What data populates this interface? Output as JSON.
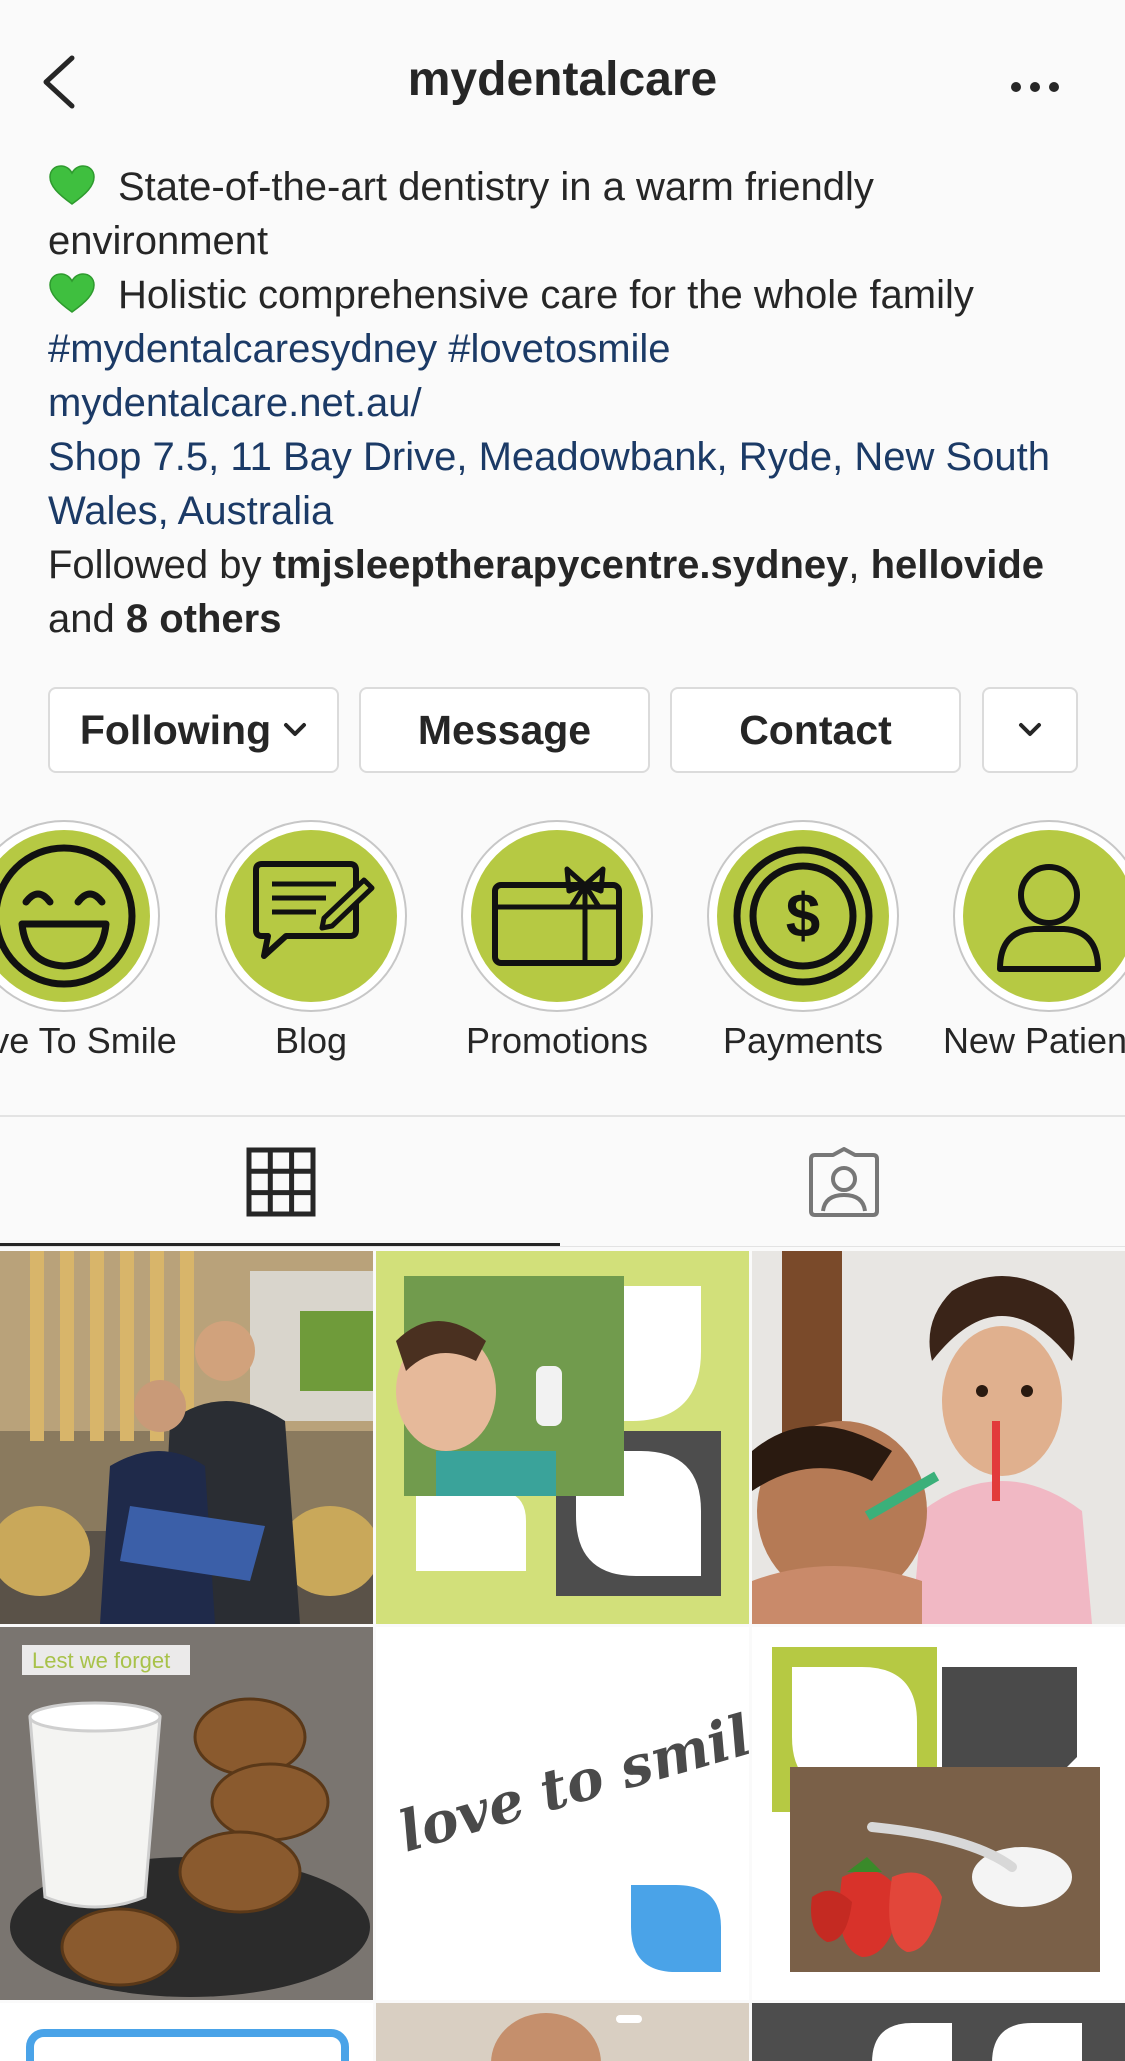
{
  "header": {
    "title": "mydentalcare",
    "back_icon": "chevron-left-icon",
    "more_icon": "ellipsis-icon"
  },
  "bio": {
    "line1": "State-of-the-art dentistry in a warm friendly environment",
    "line2": "Holistic comprehensive care for the whole family",
    "hashtags": "#mydentalcaresydney #lovetosmile",
    "website": "mydentalcare.net.au/",
    "address": "Shop 7.5, 11 Bay Drive, Meadowbank, Ryde, New South Wales, Australia",
    "followed_prefix": "Followed by",
    "follower1": "tmjsleeptherapycentre.sydney",
    "follower2": "hellovide",
    "and_text": "and",
    "others": "8 others",
    "heart_color": "#3fbf3f",
    "link_color": "#1b3a66"
  },
  "actions": {
    "following": "Following",
    "message": "Message",
    "contact": "Contact"
  },
  "highlights": [
    {
      "label": "Love To Smile",
      "icon": "smiley-face-icon"
    },
    {
      "label": "Blog",
      "icon": "chat-pencil-icon"
    },
    {
      "label": "Promotions",
      "icon": "gift-card-icon"
    },
    {
      "label": "Payments",
      "icon": "dollar-coin-icon"
    },
    {
      "label": "New Patients",
      "icon": "person-icon"
    }
  ],
  "tabs": [
    {
      "name": "grid",
      "icon": "grid-icon",
      "active": true
    },
    {
      "name": "tagged",
      "icon": "tagged-person-icon",
      "active": false
    }
  ],
  "posts": {
    "tile4_caption": "Lest we forget",
    "tile5_text": "love to smile"
  },
  "colors": {
    "brand_green": "#b6c943",
    "brand_dark": "#4a4a4a",
    "accent_blue": "#4aa3e8"
  }
}
